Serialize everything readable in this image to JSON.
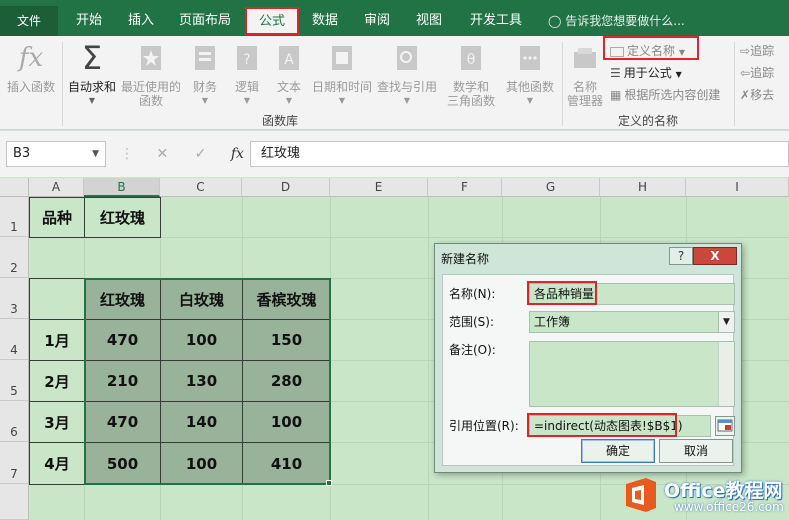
{
  "ribbon_tabs": [
    {
      "label": "文件"
    },
    {
      "label": "开始"
    },
    {
      "label": "插入"
    },
    {
      "label": "页面布局"
    },
    {
      "label": "公式"
    },
    {
      "label": "数据"
    },
    {
      "label": "审阅"
    },
    {
      "label": "视图"
    },
    {
      "label": "开发工具"
    }
  ],
  "active_tab": "公式",
  "tell_me": "告诉我您想要做什么...",
  "ribbon": {
    "insert_function": "插入函数",
    "autosum": "自动求和",
    "recent_1": "最近使用的",
    "recent_2": "函数",
    "financial": "财务",
    "logical": "逻辑",
    "text": "文本",
    "datetime": "日期和时间",
    "lookup": "查找与引用",
    "math_1": "数学和",
    "math_2": "三角函数",
    "other": "其他函数",
    "function_library": "函数库",
    "name_manager_1": "名称",
    "name_manager_2": "管理器",
    "define_name": "定义名称",
    "use_in_formula": "用于公式",
    "create_from_selection": "根据所选内容创建",
    "defined_names": "定义的名称",
    "trace_precedents": "追踪",
    "trace_dependents": "追踪",
    "remove_arrows": "移去"
  },
  "formula_bar": {
    "name_box": "B3",
    "fx": "fx",
    "value": "红玫瑰"
  },
  "sheet": {
    "columns": [
      "A",
      "B",
      "C",
      "D",
      "E",
      "F",
      "G",
      "H",
      "I"
    ],
    "rows": [
      "1",
      "2",
      "3",
      "4",
      "5",
      "6",
      "7"
    ],
    "a1": "品种",
    "b1": "红玫瑰",
    "headers": [
      "红玫瑰",
      "白玫瑰",
      "香槟玫瑰"
    ],
    "months": [
      "1月",
      "2月",
      "3月",
      "4月"
    ],
    "values": [
      [
        "470",
        "100",
        "150"
      ],
      [
        "210",
        "130",
        "280"
      ],
      [
        "470",
        "140",
        "100"
      ],
      [
        "500",
        "100",
        "410"
      ]
    ]
  },
  "dialog": {
    "title": "新建名称",
    "help": "?",
    "close": "X",
    "name_label": "名称(N):",
    "name_value": "各品种销量",
    "scope_label": "范围(S):",
    "scope_value": "工作簿",
    "comment_label": "备注(O):",
    "refers_label": "引用位置(R):",
    "refers_value": "=indirect(动态图表!$B$1)",
    "ok": "确定",
    "cancel": "取消"
  },
  "watermark": {
    "brand": "Office教程网",
    "url": "www.office26.com"
  },
  "colors": {
    "excel_green": "#217346",
    "highlight_red": "#e0242a",
    "sheet_bg": "#c9e6c8",
    "table_shade": "#98b39a"
  }
}
